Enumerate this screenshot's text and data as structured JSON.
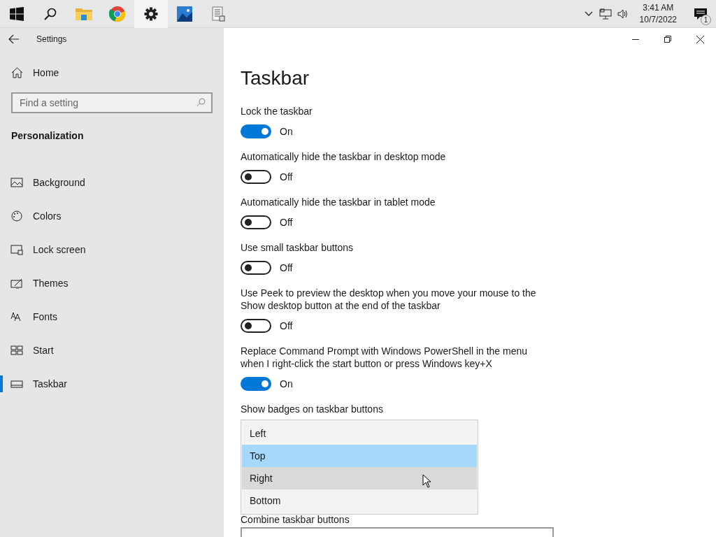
{
  "taskbar": {
    "apps": [
      {
        "kind": "start",
        "selected": false
      },
      {
        "kind": "search",
        "selected": false
      },
      {
        "kind": "folder",
        "selected": false
      },
      {
        "kind": "browser",
        "selected": false
      },
      {
        "kind": "settings",
        "selected": true
      },
      {
        "kind": "photos",
        "selected": false
      },
      {
        "kind": "document",
        "selected": false
      }
    ],
    "time": "3:41 AM",
    "date": "10/7/2022",
    "notification_count": "1"
  },
  "window": {
    "title": "Settings"
  },
  "sidebar": {
    "home": "Home",
    "search": {
      "placeholder": "Find a setting"
    },
    "section": "Personalization",
    "items": [
      {
        "label": "Background",
        "kind": "background",
        "selected": false
      },
      {
        "label": "Colors",
        "kind": "colors",
        "selected": false
      },
      {
        "label": "Lock screen",
        "kind": "lock",
        "selected": false
      },
      {
        "label": "Themes",
        "kind": "themes",
        "selected": false
      },
      {
        "label": "Fonts",
        "kind": "fonts",
        "selected": false
      },
      {
        "label": "Start",
        "kind": "start",
        "selected": false
      },
      {
        "label": "Taskbar",
        "kind": "taskbar",
        "selected": true
      }
    ]
  },
  "page": {
    "title": "Taskbar",
    "settings": [
      {
        "label": "Lock the taskbar",
        "on": true,
        "state": "On"
      },
      {
        "label": "Automatically hide the taskbar in desktop mode",
        "on": false,
        "state": "Off"
      },
      {
        "label": "Automatically hide the taskbar in tablet mode",
        "on": false,
        "state": "Off"
      },
      {
        "label": "Use small taskbar buttons",
        "on": false,
        "state": "Off"
      },
      {
        "label": "Use Peek to preview the desktop when you move your mouse to the Show desktop button at the end of the taskbar",
        "on": false,
        "state": "Off"
      },
      {
        "label": "Replace Command Prompt with Windows PowerShell in the menu when I right-click the start button or press Windows key+X",
        "on": true,
        "state": "On"
      }
    ],
    "badges_label": "Show badges on taskbar buttons",
    "dropdown": [
      {
        "label": "Left",
        "selected": false,
        "hovered": false
      },
      {
        "label": "Top",
        "selected": true,
        "hovered": false
      },
      {
        "label": "Right",
        "selected": false,
        "hovered": true
      },
      {
        "label": "Bottom",
        "selected": false,
        "hovered": false
      }
    ],
    "combine_label": "Combine taskbar buttons"
  }
}
